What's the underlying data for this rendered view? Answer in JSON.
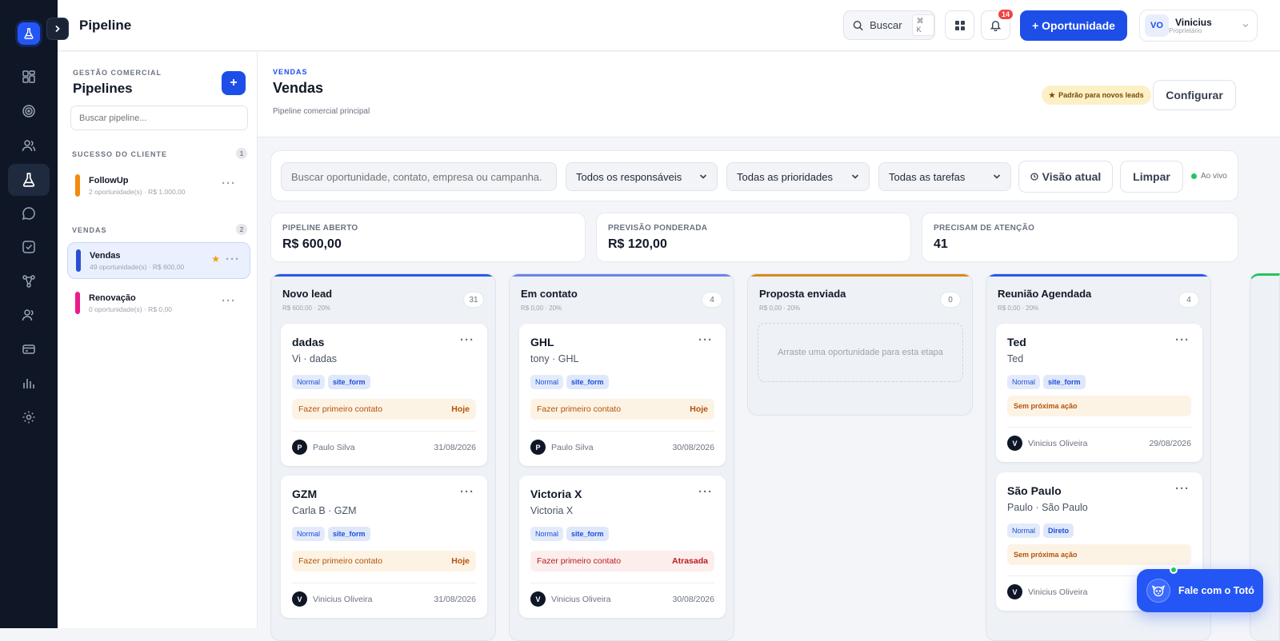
{
  "topbar": {
    "title": "Pipeline",
    "search_label": "Buscar",
    "search_shortcut": "⌘ K",
    "notifications_count": "14",
    "new_button": "+ Oportunidade",
    "user": {
      "initials": "VO",
      "name": "Vinicius",
      "role": "Proprietário"
    }
  },
  "sidebar_panel": {
    "eyebrow": "GESTÃO COMERCIAL",
    "title": "Pipelines",
    "add_label": "+",
    "search_placeholder": "Buscar pipeline...",
    "groups": [
      {
        "label": "SUCESSO DO CLIENTE",
        "count": "1",
        "items": [
          {
            "name": "FollowUp",
            "meta": "2 oportunidade(s) · R$ 1.000,00",
            "color": "#f28a0f"
          }
        ]
      },
      {
        "label": "VENDAS",
        "count": "2",
        "items": [
          {
            "name": "Vendas",
            "meta": "49 oportunidade(s) · R$ 600,00",
            "color": "#2a4fd6",
            "star": "★"
          },
          {
            "name": "Renovação",
            "meta": "0 oportunidade(s) · R$ 0,00",
            "color": "#ec1c8a"
          }
        ]
      }
    ]
  },
  "header": {
    "eyebrow": "VENDAS",
    "title": "Vendas",
    "subtitle": "Pipeline comercial principal",
    "default_badge": "Padrão para novos leads",
    "configure": "Configurar"
  },
  "filters": {
    "search_placeholder": "Buscar oportunidade, contato, empresa ou campanha.",
    "owners": "Todos os responsáveis",
    "priorities": "Todas as prioridades",
    "tasks": "Todas as tarefas",
    "view": "Visão atual",
    "clear": "Limpar",
    "live": "Ao vivo"
  },
  "kpis": [
    {
      "label": "PIPELINE ABERTO",
      "value": "R$ 600,00"
    },
    {
      "label": "PREVISÃO PONDERADA",
      "value": "R$ 120,00"
    },
    {
      "label": "PRECISAM DE ATENÇÃO",
      "value": "41"
    }
  ],
  "columns": [
    {
      "name": "Novo lead",
      "meta": "R$ 600,00 · 20%",
      "count": "31",
      "color": "#2c59e8",
      "cards": [
        {
          "title": "dadas",
          "sub": "Vi · dadas",
          "tags": [
            "Normal",
            "site_form"
          ],
          "task": "Fazer primeiro contato",
          "when": "Hoje",
          "initial": "P",
          "owner": "Paulo Silva",
          "date": "31/08/2026"
        },
        {
          "title": "GZM",
          "sub": "Carla B · GZM",
          "tags": [
            "Normal",
            "site_form"
          ],
          "task": "Fazer primeiro contato",
          "when": "Hoje",
          "initial": "V",
          "owner": "Vinicius Oliveira",
          "date": "31/08/2026"
        }
      ]
    },
    {
      "name": "Em contato",
      "meta": "R$ 0,00 · 20%",
      "count": "4",
      "color": "#6a85ea",
      "cards": [
        {
          "title": "GHL",
          "sub": "tony · GHL",
          "tags": [
            "Normal",
            "site_form"
          ],
          "task": "Fazer primeiro contato",
          "when": "Hoje",
          "initial": "P",
          "owner": "Paulo Silva",
          "date": "30/08/2026"
        },
        {
          "title": "Victoria X",
          "sub": "Victoria X",
          "tags": [
            "Normal",
            "site_form"
          ],
          "task": "Fazer primeiro contato",
          "when": "Atrasada",
          "initial": "V",
          "owner": "Vinicius Oliveira",
          "date": "30/08/2026"
        }
      ]
    },
    {
      "name": "Proposta enviada",
      "meta": "R$ 0,00 · 20%",
      "count": "0",
      "color": "#d98a1f",
      "empty": "Arraste uma oportunidade para esta etapa"
    },
    {
      "name": "Reunião Agendada",
      "meta": "R$ 0,00 · 20%",
      "count": "4",
      "color": "#2c59e8",
      "cards": [
        {
          "title": "Ted",
          "sub": "Ted",
          "tags": [
            "Normal",
            "site_form"
          ],
          "task": "Sem próxima ação",
          "initial": "V",
          "owner": "Vinicius Oliveira",
          "date": "29/08/2026"
        },
        {
          "title": "São Paulo",
          "sub": "Paulo · São Paulo",
          "tags": [
            "Normal",
            "Direto"
          ],
          "task": "Sem próxima ação",
          "initial": "V",
          "owner": "Vinicius Oliveira",
          "date": ""
        }
      ]
    }
  ],
  "chat": {
    "label": "Fale com o Totó"
  },
  "colors": {
    "accent": "#1d4ee8",
    "rail": "#0f1626"
  }
}
